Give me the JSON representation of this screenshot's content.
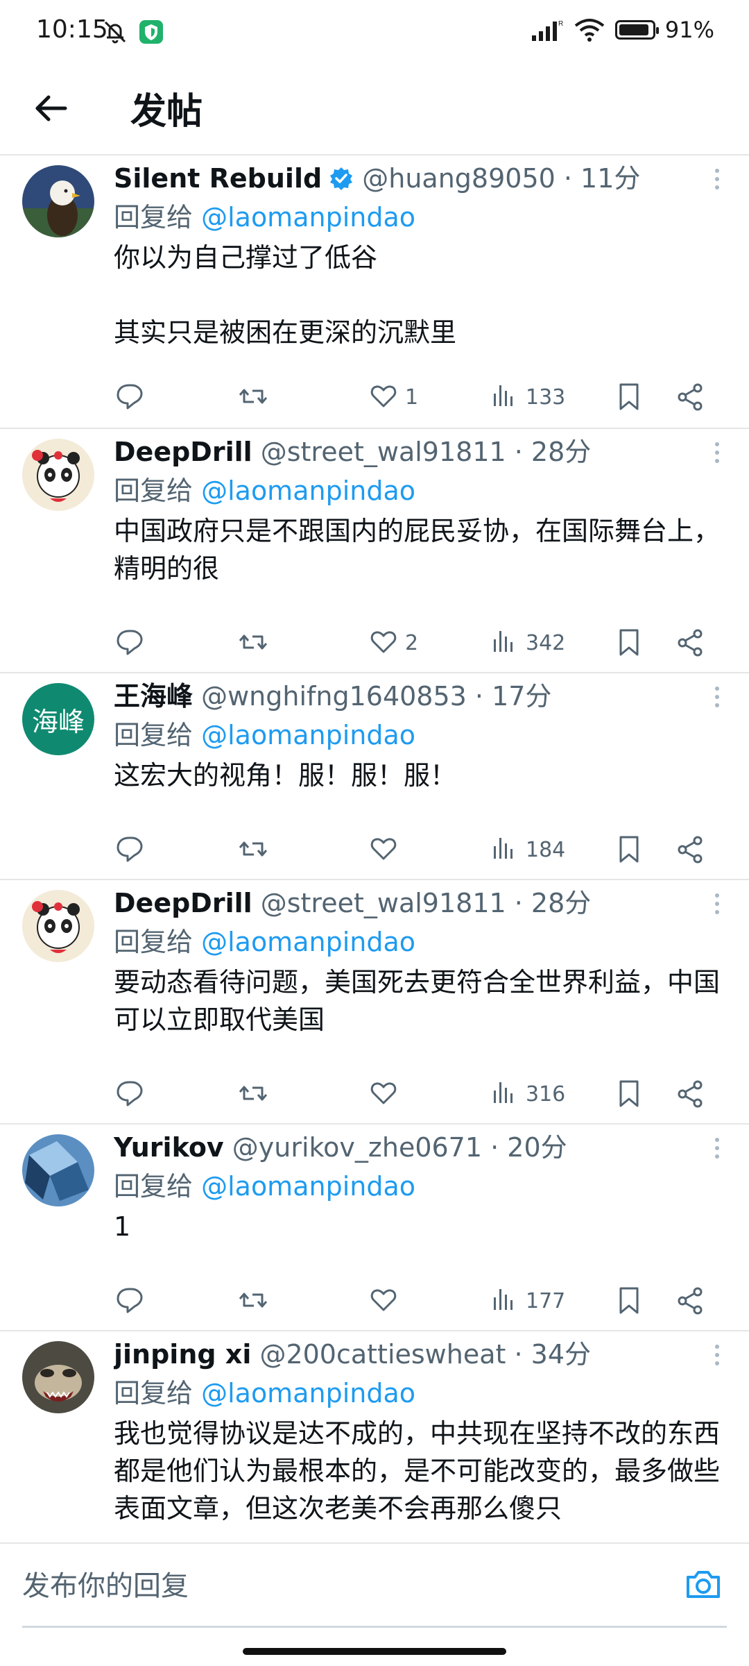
{
  "status_bar": {
    "time": "10:15",
    "battery": "91%",
    "battery_level": 0.91
  },
  "header": {
    "title": "发帖"
  },
  "reply_prefix": "回复给",
  "tweets": [
    {
      "name": "Silent Rebuild",
      "verified": true,
      "handle": "@huang89050 · 11分",
      "reply_to": "@laomanpindao",
      "text": "你以为自己撑过了低谷\n\n其实只是被困在更深的沉默里",
      "likes": "1",
      "views": "133"
    },
    {
      "name": "DeepDrill",
      "verified": false,
      "handle": "@street_wal91811 · 28分",
      "reply_to": "@laomanpindao",
      "text": "中国政府只是不跟国内的屁民妥协，在国际舞台上，精明的很",
      "likes": "2",
      "views": "342"
    },
    {
      "name": "王海峰",
      "verified": false,
      "handle": "@wnghifng1640853 · 17分",
      "reply_to": "@laomanpindao",
      "avatar_text": "海峰",
      "text": "这宏大的视角！服！服！服！",
      "likes": "",
      "views": "184"
    },
    {
      "name": "DeepDrill",
      "verified": false,
      "handle": "@street_wal91811 · 28分",
      "reply_to": "@laomanpindao",
      "text": "要动态看待问题，美国死去更符合全世界利益，中国可以立即取代美国",
      "likes": "",
      "views": "316"
    },
    {
      "name": "Yurikov",
      "verified": false,
      "handle": "@yurikov_zhe0671 · 20分",
      "reply_to": "@laomanpindao",
      "text": "1",
      "likes": "",
      "views": "177"
    },
    {
      "name": "jinping xi",
      "verified": false,
      "handle": "@200cattieswheat · 34分",
      "reply_to": "@laomanpindao",
      "text": "我也觉得协议是达不成的，中共现在坚持不改的东西都是他们认为最根本的，是不可能改变的，最多做些表面文章，但这次老美不会再那么傻只",
      "likes": "",
      "views": ""
    }
  ],
  "compose": {
    "placeholder": "发布你的回复"
  },
  "colors": {
    "accent": "#1d9bf0",
    "secondary_text": "#536471",
    "avatar_green": "#0f8a70"
  }
}
